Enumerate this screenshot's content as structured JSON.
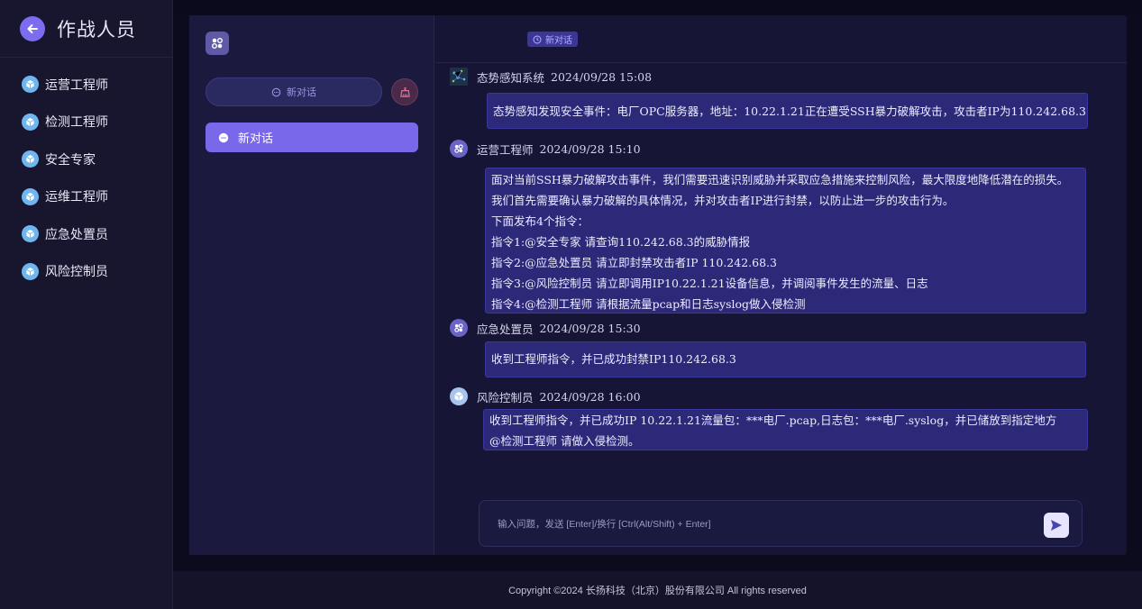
{
  "sidebar": {
    "title": "作战人员",
    "items": [
      {
        "label": "运营工程师"
      },
      {
        "label": "检测工程师"
      },
      {
        "label": "安全专家"
      },
      {
        "label": "运维工程师"
      },
      {
        "label": "应急处置员"
      },
      {
        "label": "风险控制员"
      }
    ]
  },
  "conversations": {
    "new_button_label": "新对话",
    "items": [
      {
        "label": "新对话",
        "active": true
      }
    ]
  },
  "chat": {
    "header_tag": "新对话",
    "messages": [
      {
        "sender": "态势感知系统",
        "time": "2024/09/28 15:08",
        "lines": [
          "态势感知发现安全事件：电厂OPC服务器，地址：10.22.1.21正在遭受SSH暴力破解攻击，攻击者IP为110.242.68.3"
        ]
      },
      {
        "sender": "运营工程师",
        "time": "2024/09/28 15:10",
        "lines": [
          "面对当前SSH暴力破解攻击事件，我们需要迅速识别威胁并采取应急措施来控制风险，最大限度地降低潜在的损失。",
          "我们首先需要确认暴力破解的具体情况，并对攻击者IP进行封禁，以防止进一步的攻击行为。",
          "下面发布4个指令：",
          "指令1:@安全专家 请查询110.242.68.3的威胁情报",
          "指令2:@应急处置员 请立即封禁攻击者IP 110.242.68.3",
          "指令3:@风险控制员 请立即调用IP10.22.1.21设备信息，并调阅事件发生的流量、日志",
          "指令4:@检测工程师 请根据流量pcap和日志syslog做入侵检测"
        ]
      },
      {
        "sender": "应急处置员",
        "time": "2024/09/28 15:30",
        "lines": [
          "收到工程师指令，并已成功封禁IP110.242.68.3"
        ]
      },
      {
        "sender": "风险控制员",
        "time": "2024/09/28 16:00",
        "lines": [
          "收到工程师指令，并已成功IP 10.22.1.21流量包：***电厂.pcap,日志包：***电厂.syslog，并已储放到指定地方",
          "@检测工程师 请做入侵检测。"
        ]
      }
    ],
    "input_placeholder": "输入问题，发送 [Enter]/换行 [Ctrl(Alt/Shift) + Enter]"
  },
  "footer": {
    "copyright": "Copyright ©2024 长扬科技（北京）股份有限公司 All rights reserved"
  },
  "colors": {
    "accent": "#7968ea",
    "bubble": "#2c2a78",
    "sidebar_bg": "#17162e"
  }
}
